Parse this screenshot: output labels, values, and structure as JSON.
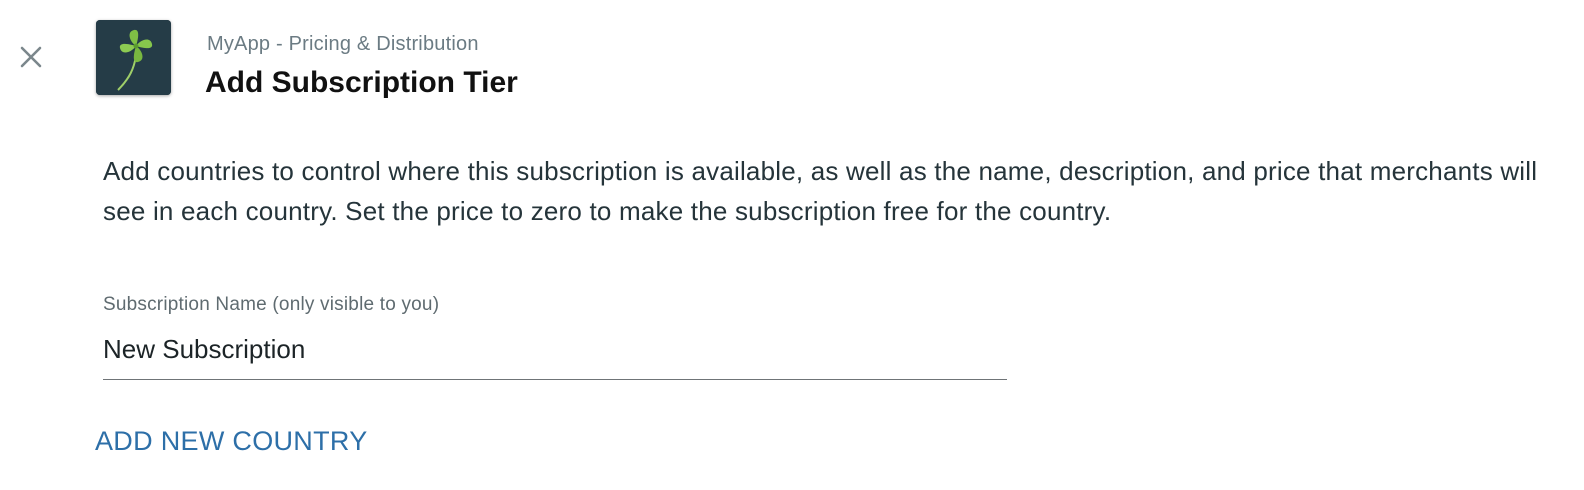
{
  "header": {
    "breadcrumb": "MyApp - Pricing & Distribution",
    "title": "Add Subscription Tier",
    "close_icon": "close-icon",
    "app_icon": "clover-app-icon"
  },
  "main": {
    "description": "Add countries to control where this subscription is available, as well as the name, description, and price that merchants will see in each country. Set the price to zero to make the subscription free for the country.",
    "subscription_name": {
      "label": "Subscription Name (only visible to you)",
      "value": "New Subscription"
    },
    "add_country_label": "ADD NEW COUNTRY"
  },
  "colors": {
    "link": "#2d6fa8",
    "breadcrumb": "#6b7b83",
    "title": "#111111"
  }
}
